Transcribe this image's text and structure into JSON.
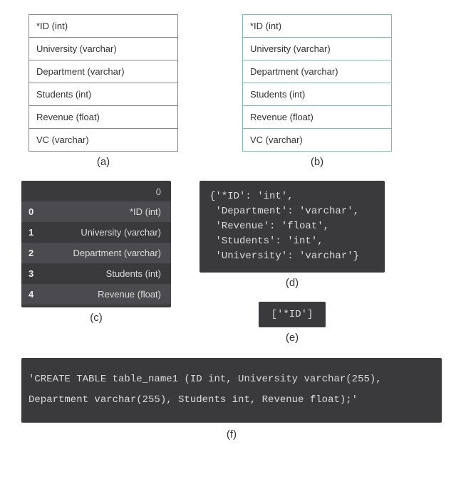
{
  "panel_a": {
    "rows": [
      "*ID (int)",
      "University (varchar)",
      "Department (varchar)",
      "Students (int)",
      "Revenue (float)",
      "VC (varchar)"
    ],
    "caption": "(a)"
  },
  "panel_b": {
    "rows": [
      "*ID (int)",
      "University (varchar)",
      "Department (varchar)",
      "Students (int)",
      "Revenue (float)",
      "VC (varchar)"
    ],
    "caption": "(b)"
  },
  "panel_c": {
    "header": "0",
    "rows": [
      {
        "idx": "0",
        "val": "*ID (int)"
      },
      {
        "idx": "1",
        "val": "University (varchar)"
      },
      {
        "idx": "2",
        "val": "Department (varchar)"
      },
      {
        "idx": "3",
        "val": "Students (int)"
      },
      {
        "idx": "4",
        "val": "Revenue (float)"
      }
    ],
    "caption": "(c)"
  },
  "panel_d": {
    "text": "{'*ID': 'int',\n 'Department': 'varchar',\n 'Revenue': 'float',\n 'Students': 'int',\n 'University': 'varchar'}",
    "caption": "(d)"
  },
  "panel_e": {
    "text": "['*ID']",
    "caption": "(e)"
  },
  "panel_f": {
    "text": "'CREATE TABLE table_name1 (ID int, University varchar(255),\n\n Department varchar(255), Students int, Revenue float);'",
    "caption": "(f)"
  }
}
